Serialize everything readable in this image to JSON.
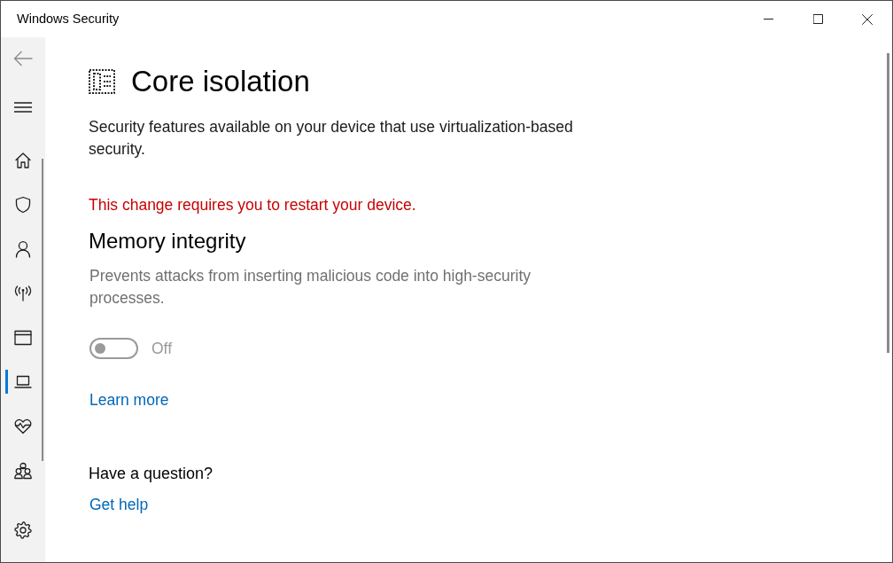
{
  "window": {
    "title": "Windows Security"
  },
  "sidebar": {
    "items": [
      {
        "selected": false
      },
      {
        "selected": false
      },
      {
        "selected": false
      },
      {
        "selected": false
      },
      {
        "selected": false
      },
      {
        "selected": true
      },
      {
        "selected": false
      },
      {
        "selected": false
      },
      {
        "selected": false
      }
    ]
  },
  "page": {
    "title": "Core isolation",
    "description": "Security features available on your device that use virtualization-based security.",
    "notice": "This change requires you to restart your device.",
    "features": [
      {
        "title": "Memory integrity",
        "description": "Prevents attacks from inserting malicious code into high-security processes.",
        "toggle": {
          "on": false,
          "disabled": true,
          "label": "Off"
        },
        "link": "Learn more"
      }
    ],
    "help": {
      "heading": "Have a question?",
      "link": "Get help"
    }
  }
}
